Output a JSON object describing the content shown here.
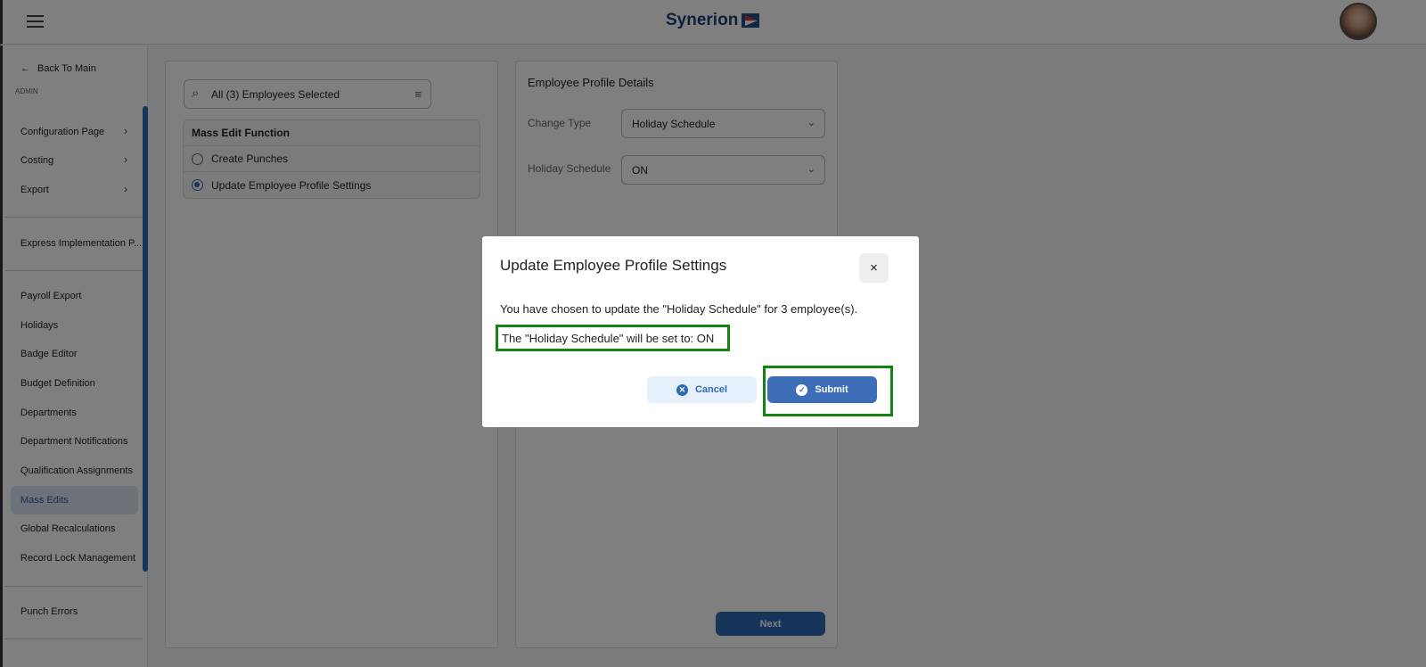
{
  "header": {
    "logo": "Synerion",
    "menu_icon": "hamburger-icon"
  },
  "sidebar": {
    "back": "Back To Main",
    "section": "ADMIN",
    "groups": [
      {
        "label": "Configuration Page"
      },
      {
        "label": "Costing"
      },
      {
        "label": "Export"
      }
    ],
    "express": "Express Implementation P...",
    "items": [
      "Payroll Export",
      "Holidays",
      "Badge Editor",
      "Budget Definition",
      "Departments",
      "Department Notifications",
      "Qualification Assignments",
      "Mass Edits",
      "Global Recalculations",
      "Record Lock Management"
    ],
    "active": "Mass Edits",
    "punch_errors": "Punch Errors"
  },
  "left_panel": {
    "search_value": "All (3) Employees Selected",
    "mef_title": "Mass Edit Function",
    "options": [
      "Create Punches",
      "Update Employee Profile Settings"
    ],
    "selected": "Update Employee Profile Settings"
  },
  "right_panel": {
    "title": "Employee Profile Details",
    "change_type_label": "Change Type",
    "change_type_value": "Holiday Schedule",
    "holiday_label": "Holiday Schedule",
    "holiday_value": "ON",
    "next": "Next"
  },
  "modal": {
    "title": "Update Employee Profile Settings",
    "close": "×",
    "message": "You have chosen to update the \"Holiday Schedule\" for 3 employee(s).",
    "set_to": "The \"Holiday Schedule\" will be set to: ON",
    "cancel": "Cancel",
    "submit": "Submit"
  },
  "colors": {
    "accent": "#2f6bb5",
    "highlight": "#138313"
  }
}
